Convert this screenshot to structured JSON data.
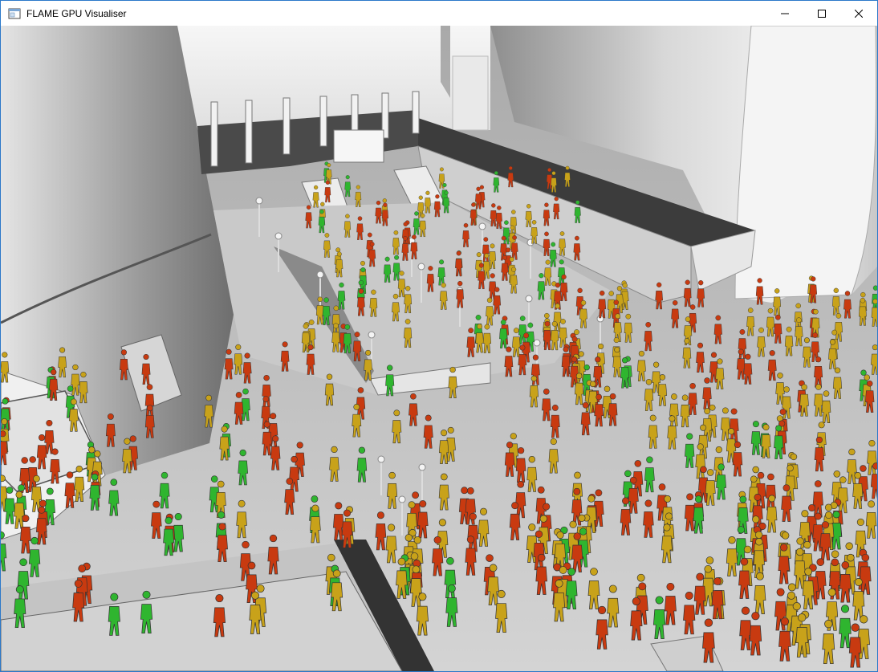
{
  "window": {
    "title": "FLAME GPU Visualiser",
    "icon": "application-window-icon",
    "controls": {
      "minimize": "minimize-icon",
      "maximize": "maximize-icon",
      "close": "close-icon"
    }
  },
  "scene": {
    "background": "#bdbdbd",
    "agent_colors": {
      "low": "#2fb52f",
      "mid": "#c8a21a",
      "high": "#c83a10"
    }
  }
}
